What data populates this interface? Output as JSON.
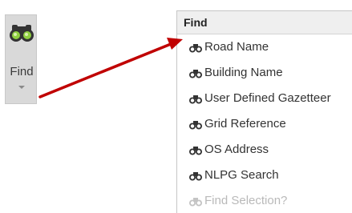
{
  "ribbon": {
    "find_label": "Find",
    "icon": "binoculars-icon"
  },
  "menu": {
    "header": "Find",
    "items": [
      {
        "label": "Road Name",
        "icon": "binoculars-icon",
        "enabled": true
      },
      {
        "label": "Building Name",
        "icon": "binoculars-icon",
        "enabled": true
      },
      {
        "label": "User Defined Gazetteer",
        "icon": "binoculars-icon",
        "enabled": true
      },
      {
        "label": "Grid Reference",
        "icon": "binoculars-icon",
        "enabled": true
      },
      {
        "label": "OS Address",
        "icon": "binoculars-icon",
        "enabled": true
      },
      {
        "label": "NLPG Search",
        "icon": "binoculars-icon",
        "enabled": true
      },
      {
        "label": "Find Selection?",
        "icon": "binoculars-icon",
        "enabled": false
      }
    ]
  },
  "colors": {
    "annotation_arrow": "#c00000",
    "binoculars_lens": "#7fbf2f"
  }
}
